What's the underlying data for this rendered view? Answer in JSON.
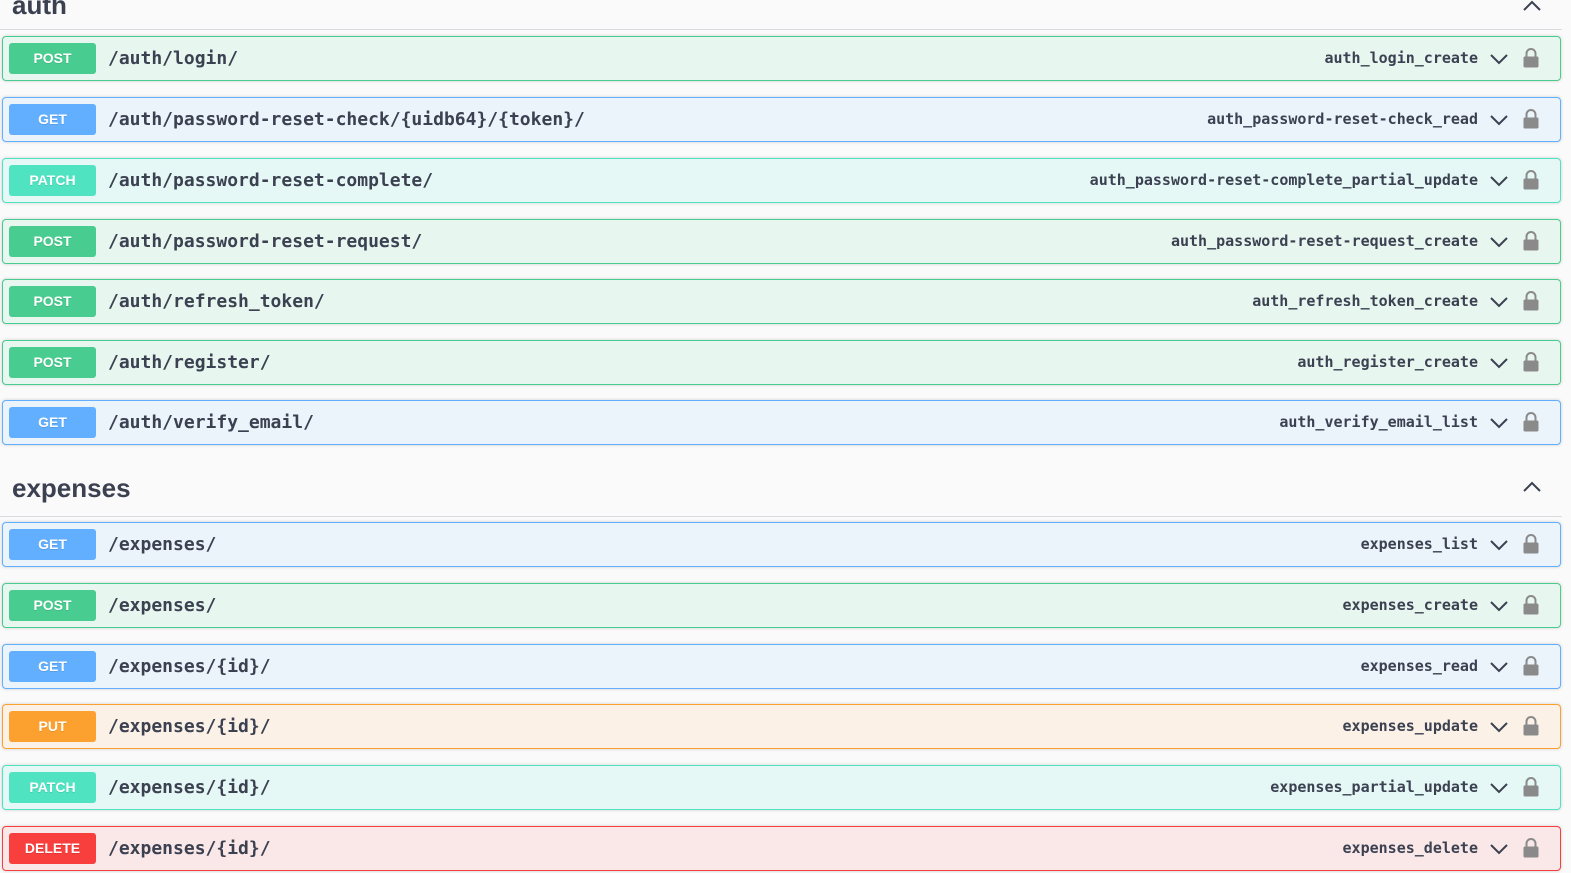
{
  "sections": [
    {
      "title": "auth",
      "operations": [
        {
          "method": "POST",
          "path": "/auth/login/",
          "operation_id": "auth_login_create"
        },
        {
          "method": "GET",
          "path": "/auth/password-reset-check/{uidb64}/{token}/",
          "operation_id": "auth_password-reset-check_read"
        },
        {
          "method": "PATCH",
          "path": "/auth/password-reset-complete/",
          "operation_id": "auth_password-reset-complete_partial_update"
        },
        {
          "method": "POST",
          "path": "/auth/password-reset-request/",
          "operation_id": "auth_password-reset-request_create"
        },
        {
          "method": "POST",
          "path": "/auth/refresh_token/",
          "operation_id": "auth_refresh_token_create"
        },
        {
          "method": "POST",
          "path": "/auth/register/",
          "operation_id": "auth_register_create"
        },
        {
          "method": "GET",
          "path": "/auth/verify_email/",
          "operation_id": "auth_verify_email_list"
        }
      ]
    },
    {
      "title": "expenses",
      "operations": [
        {
          "method": "GET",
          "path": "/expenses/",
          "operation_id": "expenses_list"
        },
        {
          "method": "POST",
          "path": "/expenses/",
          "operation_id": "expenses_create"
        },
        {
          "method": "GET",
          "path": "/expenses/{id}/",
          "operation_id": "expenses_read"
        },
        {
          "method": "PUT",
          "path": "/expenses/{id}/",
          "operation_id": "expenses_update"
        },
        {
          "method": "PATCH",
          "path": "/expenses/{id}/",
          "operation_id": "expenses_partial_update"
        },
        {
          "method": "DELETE",
          "path": "/expenses/{id}/",
          "operation_id": "expenses_delete"
        }
      ]
    }
  ],
  "icons": {
    "section_toggle": "chevron-up-icon",
    "op_expand": "chevron-down-icon",
    "op_auth": "lock-icon"
  },
  "colors": {
    "POST": "#49cc90",
    "GET": "#61affe",
    "PATCH": "#50e3c2",
    "PUT": "#fca130",
    "DELETE": "#f93e3e"
  }
}
